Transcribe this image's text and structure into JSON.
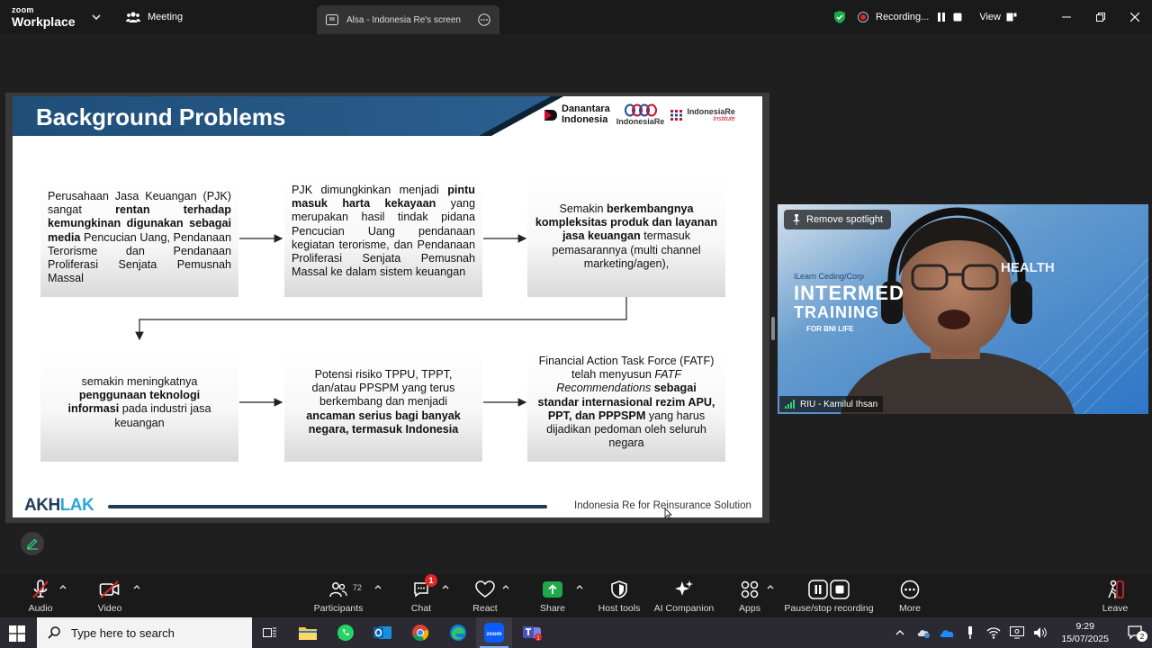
{
  "titlebar": {
    "brand_top": "zoom",
    "brand_bottom": "Workplace",
    "meeting_label": "Meeting",
    "share_tab_label": "Alsa - Indonesia Re's screen",
    "recording_label": "Recording...",
    "view_label": "View"
  },
  "slide": {
    "title": "Background Problems",
    "logo_danantara_1": "Danantara",
    "logo_danantara_2": "Indonesia",
    "logo_indonesiare": "IndonesiaRe",
    "logo_institute_1": "IndonesiaRe",
    "logo_institute_2": "Institute",
    "boxes": [
      {
        "segments": [
          {
            "t": "Perusahaan Jasa Keuangan (PJK) sangat ",
            "b": false
          },
          {
            "t": "rentan terhadap kemungkinan digunakan sebagai media",
            "b": true
          },
          {
            "t": " Pencucian Uang, Pendanaan Terorisme dan Pendanaan Proliferasi Senjata Pemusnah Massal",
            "b": false
          }
        ]
      },
      {
        "segments": [
          {
            "t": "PJK dimungkinkan menjadi ",
            "b": false
          },
          {
            "t": "pintu masuk harta kekayaan",
            "b": true
          },
          {
            "t": " yang merupakan hasil tindak pidana Pencucian Uang pendanaan kegiatan terorisme, dan Pendanaan Proliferasi Senjata Pemusnah Massal ke dalam sistem keuangan",
            "b": false
          }
        ]
      },
      {
        "segments": [
          {
            "t": "Semakin ",
            "b": false
          },
          {
            "t": "berkembangnya kompleksitas produk dan layanan jasa keuangan",
            "b": true
          },
          {
            "t": " termasuk pemasarannya (multi channel marketing/agen),",
            "b": false
          }
        ]
      },
      {
        "segments": [
          {
            "t": "semakin meningkatnya ",
            "b": false
          },
          {
            "t": "penggunaan teknologi informasi",
            "b": true
          },
          {
            "t": " pada industri jasa keuangan",
            "b": false
          }
        ]
      },
      {
        "segments": [
          {
            "t": "Potensi risiko TPPU, TPPT, dan/atau PPSPM yang terus berkembang dan menjadi ",
            "b": false
          },
          {
            "t": "ancaman serius bagi banyak negara, termasuk Indonesia",
            "b": true
          }
        ]
      },
      {
        "segments": [
          {
            "t": "Financial Action Task Force (FATF) telah menyusun ",
            "b": false
          },
          {
            "t": "FATF Recommendations",
            "b": false,
            "i": true
          },
          {
            "t": " sebagai standar internasional rezim APU, PPT, dan PPPSPM",
            "b": true
          },
          {
            "t": " yang harus dijadikan pedoman oleh seluruh negara",
            "b": false
          }
        ]
      }
    ],
    "footer_brand_a": "AKH",
    "footer_brand_b": "LAK",
    "footer_text": "Indonesia Re for Reinsurance Solution"
  },
  "video": {
    "remove_spotlight": "Remove spotlight",
    "participant_name": "RIU - Kamilul Ihsan",
    "bg_line1": "INTERMED",
    "bg_line2": "TRAINING",
    "bg_line3": "FOR BNI LIFE",
    "bg_health": "HEALTH",
    "bg_small": "iLearn Ceding/Corp"
  },
  "toolbar": {
    "audio": "Audio",
    "video": "Video",
    "participants": "Participants",
    "participants_count": "72",
    "chat": "Chat",
    "chat_badge": "1",
    "react": "React",
    "share": "Share",
    "host_tools": "Host tools",
    "ai_companion": "AI Companion",
    "apps": "Apps",
    "pause_stop": "Pause/stop recording",
    "more": "More",
    "leave": "Leave"
  },
  "taskbar": {
    "search_placeholder": "Type here to search",
    "time": "9:29",
    "date": "15/07/2025",
    "notif_count": "2"
  },
  "colors": {
    "slide_header_blue": "#1f4e79",
    "zoom_green": "#1ca84b",
    "badge_red": "#e02828"
  }
}
